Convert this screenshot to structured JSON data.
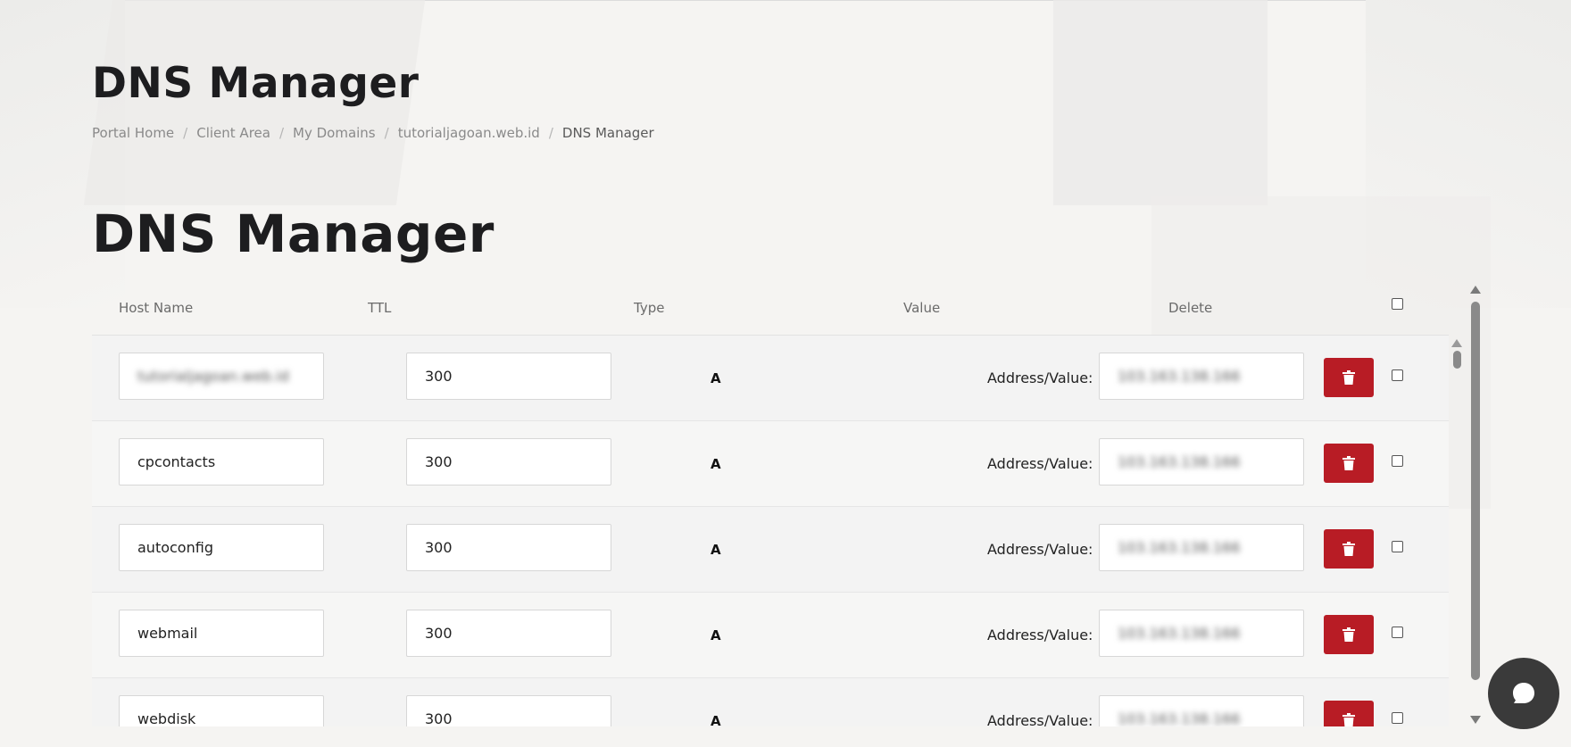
{
  "page": {
    "title": "DNS Manager"
  },
  "breadcrumb": [
    {
      "label": "Portal Home"
    },
    {
      "label": "Client Area"
    },
    {
      "label": "My Domains"
    },
    {
      "label": "tutorialjagoan.web.id"
    },
    {
      "label": "DNS Manager"
    }
  ],
  "section": {
    "title": "DNS Manager"
  },
  "table": {
    "headers": {
      "host": "Host Name",
      "ttl": "TTL",
      "type": "Type",
      "value": "Value",
      "delete": "Delete"
    },
    "address_label": "Address/Value:",
    "rows": [
      {
        "host": "tutorialjagoan.web.id",
        "host_blurred": true,
        "ttl": "300",
        "type": "A",
        "value": "103.163.138.166"
      },
      {
        "host": "cpcontacts",
        "ttl": "300",
        "type": "A",
        "value": "103.163.138.166"
      },
      {
        "host": "autoconfig",
        "ttl": "300",
        "type": "A",
        "value": "103.163.138.166"
      },
      {
        "host": "webmail",
        "ttl": "300",
        "type": "A",
        "value": "103.163.138.166"
      },
      {
        "host": "webdisk",
        "ttl": "300",
        "type": "A",
        "value": "103.163.138.166"
      }
    ]
  },
  "colors": {
    "delete_button": "#b81c25",
    "chat_button": "#3a3a3a"
  },
  "icons": {
    "delete": "trash-icon",
    "chat": "chat-bubble-icon"
  }
}
